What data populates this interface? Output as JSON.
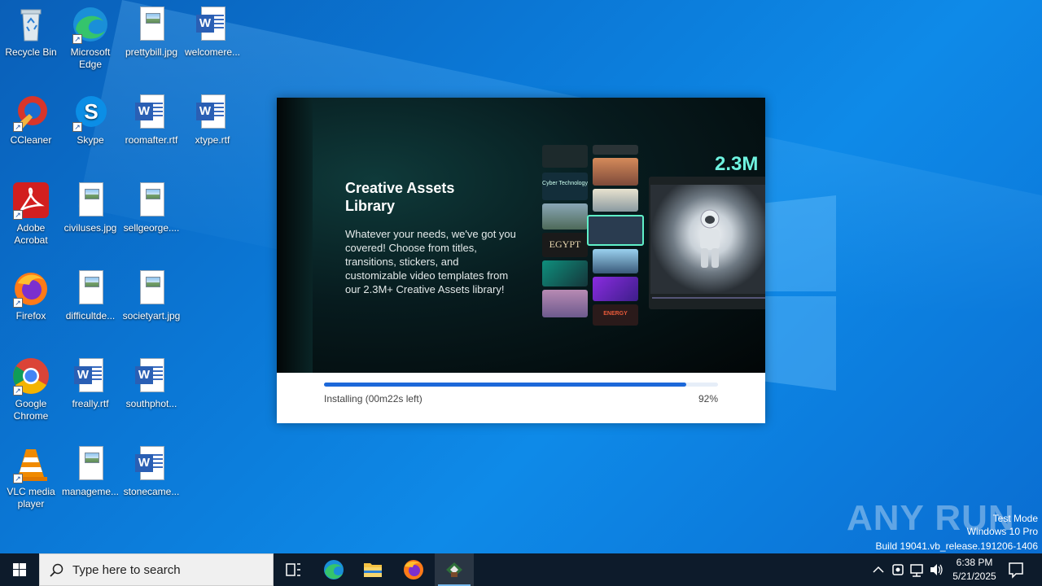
{
  "desktop": {
    "icons": [
      {
        "label": "Recycle Bin"
      },
      {
        "label": "Microsoft Edge"
      },
      {
        "label": "prettybill.jpg"
      },
      {
        "label": "welcomere..."
      },
      {
        "label": "CCleaner"
      },
      {
        "label": "Skype"
      },
      {
        "label": "roomafter.rtf"
      },
      {
        "label": "xtype.rtf"
      },
      {
        "label": "Adobe Acrobat"
      },
      {
        "label": "civiluses.jpg"
      },
      {
        "label": "sellgeorge...."
      },
      {
        "label": "Firefox"
      },
      {
        "label": "difficultde..."
      },
      {
        "label": "societyart.jpg"
      },
      {
        "label": "Google Chrome"
      },
      {
        "label": "freally.rtf"
      },
      {
        "label": "southphot..."
      },
      {
        "label": "VLC media player"
      },
      {
        "label": "manageme..."
      },
      {
        "label": "stonecame..."
      }
    ]
  },
  "installer": {
    "title": "Creative Assets Library",
    "description": "Whatever your needs, we've got you covered! Choose from titles, transitions, stickers, and customizable video templates from our 2.3M+ Creative Assets library!",
    "stat": "2.3M",
    "thumb_texts": [
      "Cyber Technology",
      "EGYPT",
      "ENERGY"
    ],
    "progress": {
      "status": "Installing (00m22s left)",
      "percent_label": "92%",
      "value": 0.92
    },
    "accent_color": "#1c68d9"
  },
  "watermark": {
    "logo": "ANY RUN",
    "lines": [
      "Test Mode",
      "Windows 10 Pro",
      "Build 19041.vb_release.191206-1406"
    ]
  },
  "taskbar": {
    "search_placeholder": "Type here to search",
    "clock_time": "6:38 PM",
    "clock_date": "5/21/2025"
  }
}
